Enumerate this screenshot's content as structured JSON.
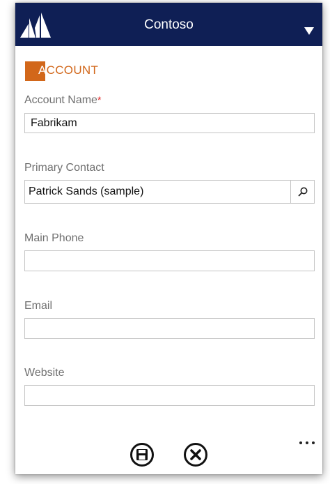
{
  "header": {
    "title": "Contoso",
    "logo_icon": "crm-sailboat-logo-icon",
    "menu_icon": "dropdown-triangle-icon",
    "bar_color": "#0f1f55"
  },
  "entity": {
    "label": "ACCOUNT",
    "accent_color": "#d2671a"
  },
  "form": {
    "account_name": {
      "label": "Account Name",
      "required_marker": "*",
      "value": "Fabrikam"
    },
    "primary_contact": {
      "label": "Primary Contact",
      "value": "Patrick Sands (sample)",
      "lookup_icon": "search-icon"
    },
    "main_phone": {
      "label": "Main Phone",
      "value": ""
    },
    "email": {
      "label": "Email",
      "value": ""
    },
    "website": {
      "label": "Website",
      "value": ""
    }
  },
  "commands": {
    "save_icon": "save-icon",
    "cancel_icon": "close-icon",
    "more_icon": "more-ellipsis-icon"
  }
}
